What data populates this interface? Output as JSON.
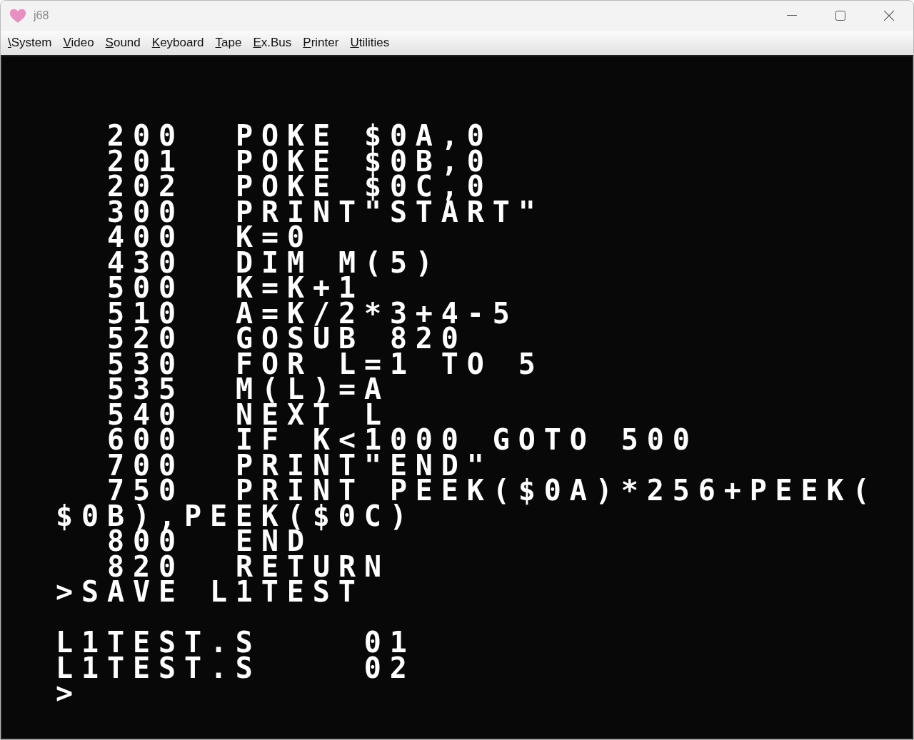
{
  "window": {
    "title": "j68"
  },
  "menu": [
    {
      "mnemonic": "\\",
      "rest": "System"
    },
    {
      "mnemonic": "V",
      "rest": "ideo"
    },
    {
      "mnemonic": "S",
      "rest": "ound"
    },
    {
      "mnemonic": "K",
      "rest": "eyboard"
    },
    {
      "mnemonic": "T",
      "rest": "ape"
    },
    {
      "mnemonic": "E",
      "rest": "x.Bus"
    },
    {
      "mnemonic": "P",
      "rest": "rinter"
    },
    {
      "mnemonic": "U",
      "rest": "tilities"
    }
  ],
  "screen": {
    "lines": [
      {
        "kind": "program",
        "number": "200",
        "statement": "POKE $0A,0"
      },
      {
        "kind": "program",
        "number": "201",
        "statement": "POKE $0B,0"
      },
      {
        "kind": "program",
        "number": "202",
        "statement": "POKE $0C,0"
      },
      {
        "kind": "program",
        "number": "300",
        "statement": "PRINT\"START\""
      },
      {
        "kind": "program",
        "number": "400",
        "statement": "K=0"
      },
      {
        "kind": "program",
        "number": "430",
        "statement": "DIM M(5)"
      },
      {
        "kind": "program",
        "number": "500",
        "statement": "K=K+1"
      },
      {
        "kind": "program",
        "number": "510",
        "statement": "A=K/2*3+4-5"
      },
      {
        "kind": "program",
        "number": "520",
        "statement": "GOSUB 820"
      },
      {
        "kind": "program",
        "number": "530",
        "statement": "FOR L=1 TO 5"
      },
      {
        "kind": "program",
        "number": "535",
        "statement": "M(L)=A"
      },
      {
        "kind": "program",
        "number": "540",
        "statement": "NEXT L"
      },
      {
        "kind": "program",
        "number": "600",
        "statement": "IF K<1000 GOTO 500"
      },
      {
        "kind": "program",
        "number": "700",
        "statement": "PRINT\"END\""
      },
      {
        "kind": "program",
        "number": "750",
        "statement": "PRINT PEEK($0A)*256+PEEK("
      },
      {
        "kind": "text",
        "text": "$0B),PEEK($0C)"
      },
      {
        "kind": "program",
        "number": "800",
        "statement": "END"
      },
      {
        "kind": "program",
        "number": "820",
        "statement": "RETURN"
      },
      {
        "kind": "text",
        "text": ">SAVE L1TEST"
      },
      {
        "kind": "blank"
      },
      {
        "kind": "text",
        "text": "L1TEST.S    01"
      },
      {
        "kind": "text",
        "text": "L1TEST.S    02"
      },
      {
        "kind": "text",
        "text": ">"
      }
    ]
  }
}
